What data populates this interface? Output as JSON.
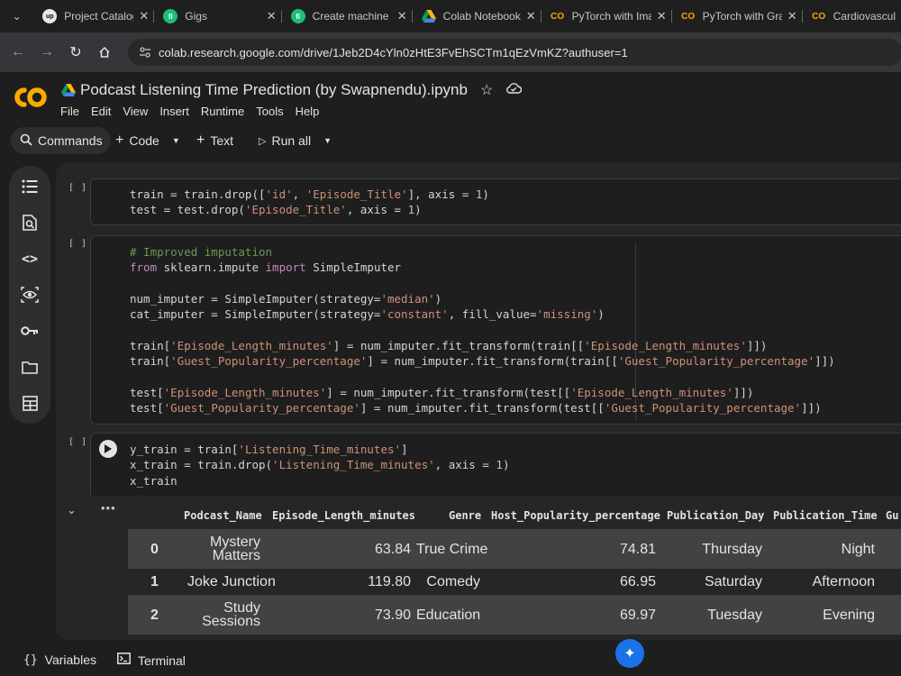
{
  "browser": {
    "tabs": [
      {
        "title": "Project Catalog |",
        "favicon": "upwork-icon"
      },
      {
        "title": "Gigs",
        "favicon": "fiverr-icon"
      },
      {
        "title": "Create machine l",
        "favicon": "fiverr-icon"
      },
      {
        "title": "Colab Notebook",
        "favicon": "google-drive-icon"
      },
      {
        "title": "PyTorch with Ima",
        "favicon": "colab-icon"
      },
      {
        "title": "PyTorch with Gra",
        "favicon": "colab-icon"
      },
      {
        "title": "Cardiovascul",
        "favicon": "colab-icon"
      }
    ],
    "url": "colab.research.google.com/drive/1Jeb2D4cYln0zHtE3FvEhSCTm1qEzVmKZ?authuser=1"
  },
  "colab": {
    "notebook_title": "Podcast Listening Time Prediction (by Swapnendu).ipynb",
    "menu": [
      "File",
      "Edit",
      "View",
      "Insert",
      "Runtime",
      "Tools",
      "Help"
    ],
    "toolbar": {
      "commands": "Commands",
      "code": "Code",
      "text": "Text",
      "run_all": "Run all"
    }
  },
  "cells": {
    "bracket": "[ ]",
    "cell1": {
      "line1": "train = train.drop(['id', 'Episode_Title'], axis = 1)",
      "line2": "test = test.drop('Episode_Title', axis = 1)"
    },
    "cell2": {
      "comment": "# Improved imputation",
      "import": "from sklearn.impute import SimpleImputer",
      "num_imputer": "num_imputer = SimpleImputer(strategy='median')",
      "cat_imputer": "cat_imputer = SimpleImputer(strategy='constant', fill_value='missing')",
      "train_ep": "train['Episode_Length_minutes'] = num_imputer.fit_transform(train[['Episode_Length_minutes']])",
      "train_guest": "train['Guest_Popularity_percentage'] = num_imputer.fit_transform(train[['Guest_Popularity_percentage']])",
      "test_ep": "test['Episode_Length_minutes'] = num_imputer.fit_transform(test[['Episode_Length_minutes']])",
      "test_guest": "test['Guest_Popularity_percentage'] = num_imputer.fit_transform(test[['Guest_Popularity_percentage']])"
    },
    "cell3": {
      "line1": "y_train = train['Listening_Time_minutes']",
      "line2": "x_train = train.drop('Listening_Time_minutes', axis = 1)",
      "line3": "x_train"
    }
  },
  "dataframe": {
    "columns": [
      "Podcast_Name",
      "Episode_Length_minutes",
      "Genre",
      "Host_Popularity_percentage",
      "Publication_Day",
      "Publication_Time",
      "Gu"
    ],
    "rows": [
      {
        "index": "0",
        "podcast_l1": "Mystery",
        "podcast_l2": "Matters",
        "episode_length": "63.84",
        "genre": "True Crime",
        "host_pop": "74.81",
        "day": "Thursday",
        "time": "Night"
      },
      {
        "index": "1",
        "podcast_l1": "Joke Junction",
        "podcast_l2": "",
        "episode_length": "119.80",
        "genre": "Comedy",
        "host_pop": "66.95",
        "day": "Saturday",
        "time": "Afternoon"
      },
      {
        "index": "2",
        "podcast_l1": "Study",
        "podcast_l2": "Sessions",
        "episode_length": "73.90",
        "genre": "Education",
        "host_pop": "69.97",
        "day": "Tuesday",
        "time": "Evening"
      }
    ]
  },
  "bottombar": {
    "variables": "Variables",
    "terminal": "Terminal"
  },
  "colors": {
    "accent_orange": "#f9ab00",
    "background": "#1e1e1e",
    "string": "#ce9178",
    "keyword": "#c586c0",
    "comment": "#6a9955",
    "number": "#b5cea8"
  }
}
